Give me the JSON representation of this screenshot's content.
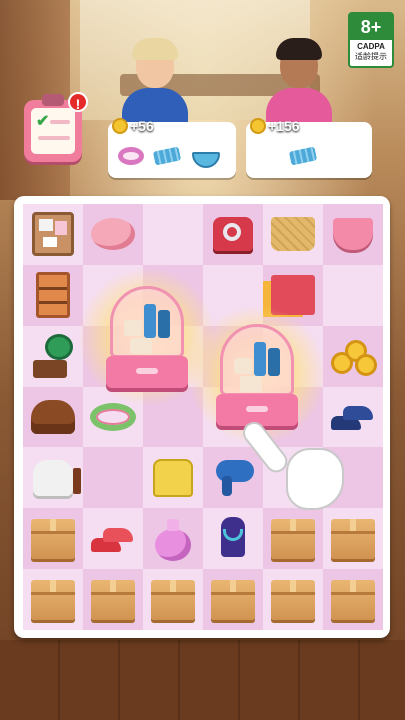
{
  "rating": {
    "age": "8+",
    "org": "CADPA",
    "tip": "适龄提示"
  },
  "tasks": {
    "alert": "!"
  },
  "orders": [
    {
      "reward": "+56",
      "items": [
        "bracelet-icon",
        "hair-clip-icon",
        "bowl-whisk-icon"
      ]
    },
    {
      "reward": "+156",
      "items": [
        "hair-clip-icon"
      ]
    }
  ],
  "board": {
    "columns": 6,
    "rows": 7,
    "cells": [
      [
        "corkboard",
        "piggy-bank",
        "",
        "ring-box",
        "quilted-handbag",
        "teacup"
      ],
      [
        "wardrobe-shelf",
        "generator",
        "generator",
        "",
        "shopping-bags",
        ""
      ],
      [
        "phonograph",
        "generator",
        "generator",
        "generator",
        "generator",
        "gold-coins"
      ],
      [
        "bread-loaf",
        "flower-wreath",
        "",
        "generator",
        "generator",
        "blue-heels"
      ],
      [
        "aroma-diffuser",
        "",
        "yellow-jacket",
        "hair-dryer",
        "",
        ""
      ],
      [
        "box",
        "red-heels",
        "perfume-bottle",
        "jewelry-bust",
        "box",
        "box"
      ],
      [
        "box",
        "box",
        "box",
        "box",
        "box",
        "box"
      ]
    ]
  },
  "generators": [
    "cosmetics-case-generator",
    "cosmetics-case-generator"
  ],
  "colors": {
    "cell_light": "#f5def2",
    "cell_dark": "#ecc6e4",
    "accent": "#f37aa5"
  }
}
